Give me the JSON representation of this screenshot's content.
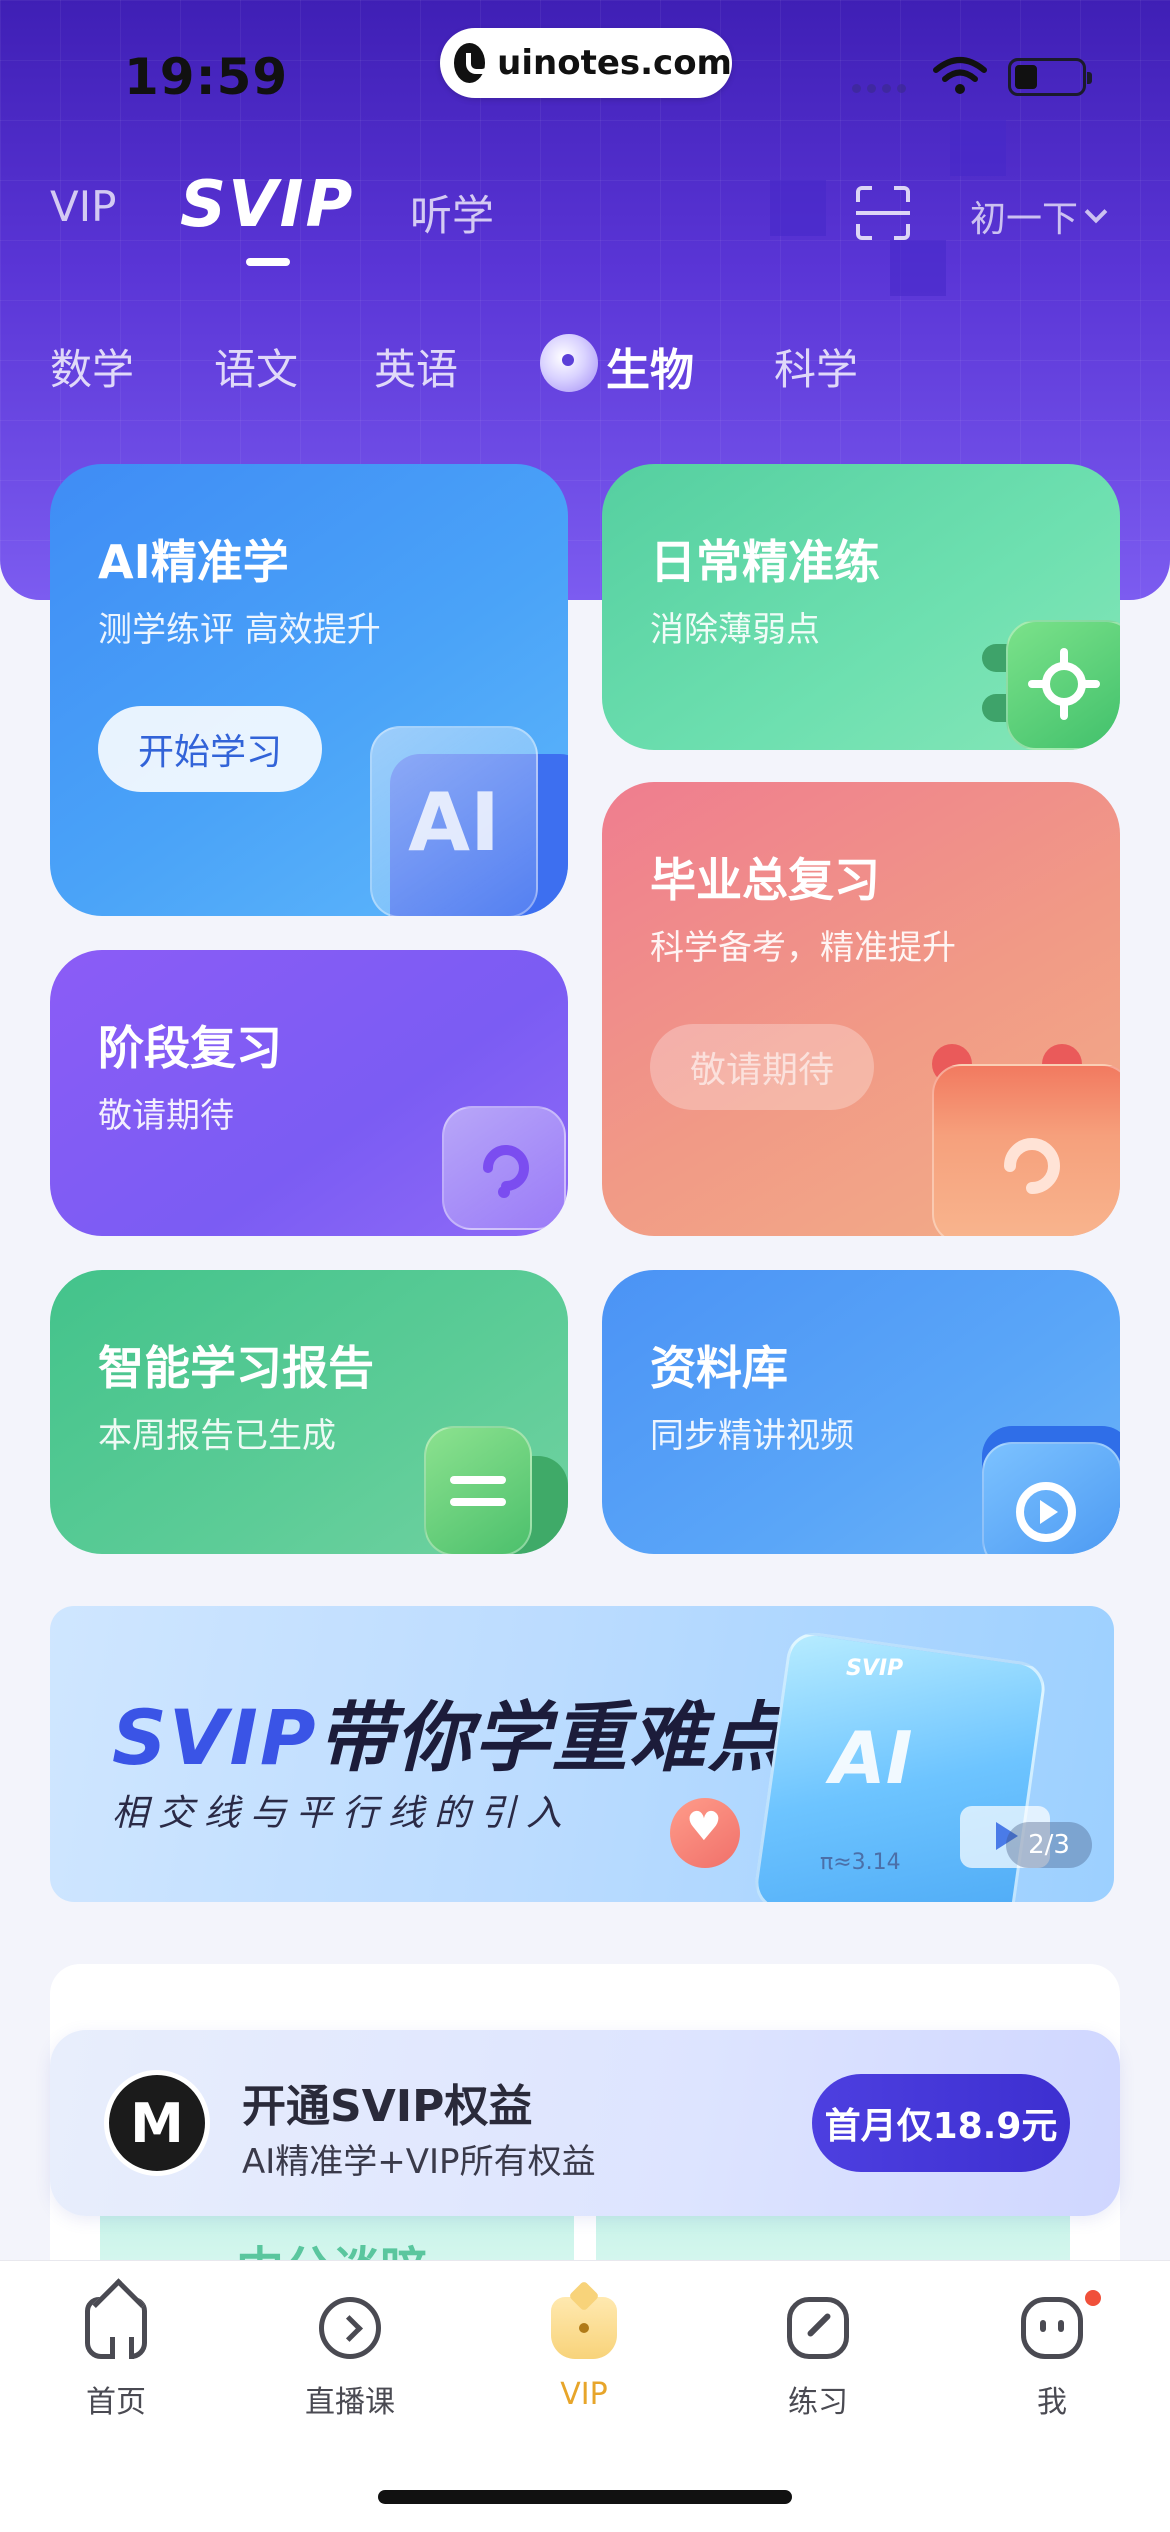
{
  "status_bar": {
    "time": "19:59",
    "watermark": "uinotes.com"
  },
  "top_tabs": {
    "items": [
      {
        "label": "VIP"
      },
      {
        "label": "SVIP"
      },
      {
        "label": "听学"
      }
    ],
    "active": "SVIP",
    "grade_label": "初一下"
  },
  "subjects": {
    "items": [
      {
        "label": "数学"
      },
      {
        "label": "语文"
      },
      {
        "label": "英语"
      },
      {
        "label": "生物"
      },
      {
        "label": "科学"
      }
    ],
    "active": "生物"
  },
  "cards": [
    {
      "title": "AI精准学",
      "subtitle": "测学练评 高效提升",
      "button": "开始学习",
      "badge_text": "AI"
    },
    {
      "title": "日常精准练",
      "subtitle": "消除薄弱点"
    },
    {
      "title": "阶段复习",
      "subtitle": "敬请期待"
    },
    {
      "title": "毕业总复习",
      "subtitle": "科学备考，精准提升",
      "button": "敬请期待"
    },
    {
      "title": "智能学习报告",
      "subtitle": "本周报告已生成"
    },
    {
      "title": "资料库",
      "subtitle": "同步精讲视频"
    }
  ],
  "banner": {
    "title_brand": "SVIP",
    "title_rest": "带你学重难点",
    "subtitle": "相交线与平行线的引入",
    "art_brand": "SVIP",
    "art_ai": "AI",
    "art_formula": "π≈3.14",
    "page_indicator": "2/3"
  },
  "svip_offer": {
    "logo_letter": "M",
    "title": "开通SVIP权益",
    "subtitle": "AI精准学+VIP所有权益",
    "button": "首月仅18.9元"
  },
  "peek_text": "中分谈暗",
  "bottom_nav": {
    "items": [
      {
        "label": "首页",
        "icon": "home-icon"
      },
      {
        "label": "直播课",
        "icon": "live-icon"
      },
      {
        "label": "VIP",
        "icon": "crown-icon"
      },
      {
        "label": "练习",
        "icon": "pencil-icon"
      },
      {
        "label": "我",
        "icon": "face-icon"
      }
    ],
    "active": "VIP",
    "active_color": "#e7a52a"
  },
  "colors": {
    "hero": "#4a2bc8",
    "offer_button": "#4035d6"
  }
}
